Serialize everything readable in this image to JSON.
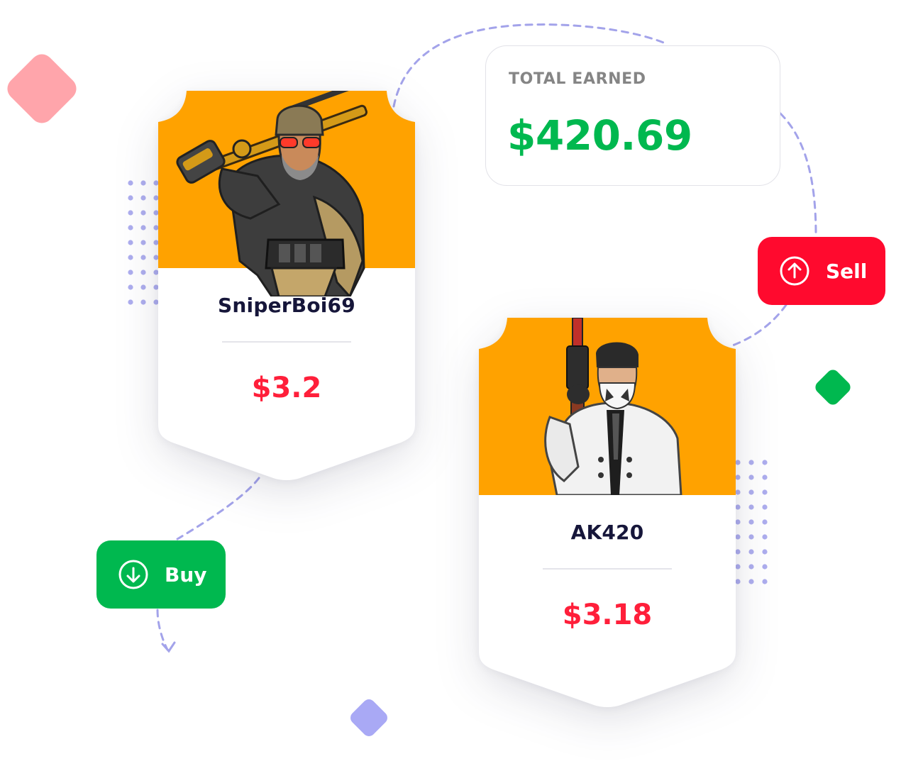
{
  "earned": {
    "label": "TOTAL EARNED",
    "value": "$420.69"
  },
  "cards": [
    {
      "name": "SniperBoi69",
      "price": "$3.2",
      "avatar_icon": "sniper-character-icon"
    },
    {
      "name": "AK420",
      "price": "$3.18",
      "avatar_icon": "ak-character-icon"
    }
  ],
  "actions": {
    "sell_label": "Sell",
    "buy_label": "Buy",
    "sell_icon": "arrow-up-circle-icon",
    "buy_icon": "arrow-down-circle-icon"
  },
  "colors": {
    "card_header": "#ffa200",
    "price": "#ff1f3a",
    "earned": "#00b84f",
    "sell": "#ff0a2e",
    "buy": "#00b84f",
    "dots": "#aeaeee",
    "dash": "#a3a3ea",
    "deco_pink": "#ffa5ab",
    "deco_green": "#00b84f",
    "deco_lavender": "#a9a9f5"
  }
}
